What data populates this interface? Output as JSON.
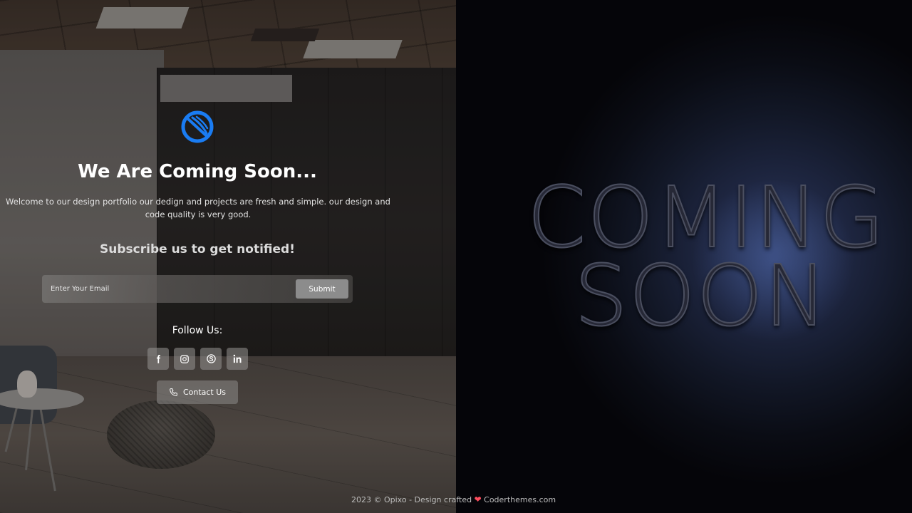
{
  "brand": {
    "logo_icon": "opixo-logo-icon",
    "accent_color": "#1a7cf2"
  },
  "hero": {
    "title": "We Are Coming Soon...",
    "description": "Welcome to our design portfolio our dedign and projects are fresh and simple. our design and code quality is very good."
  },
  "subscribe": {
    "title": "Subscribe us to get notified!",
    "email_placeholder": "Enter Your Email",
    "submit_label": "Submit"
  },
  "social": {
    "label": "Follow Us:",
    "items": [
      {
        "icon": "facebook-icon"
      },
      {
        "icon": "instagram-icon"
      },
      {
        "icon": "skype-icon"
      },
      {
        "icon": "linkedin-icon"
      }
    ]
  },
  "contact": {
    "label": "Contact Us",
    "icon": "phone-icon"
  },
  "artwork": {
    "line1": "COMING",
    "line2": "SOON"
  },
  "footer": {
    "prefix": "2023 © Opixo - Design crafted",
    "heart_color": "#ff4d5e",
    "suffix": "Coderthemes.com"
  }
}
